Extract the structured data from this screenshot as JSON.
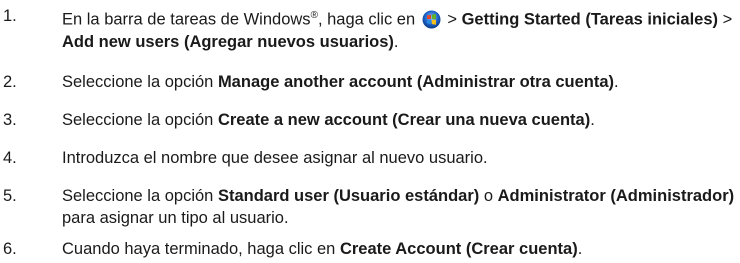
{
  "steps": [
    {
      "number": "1.",
      "parts": {
        "t1": "En la barra de tareas de Windows",
        "reg": "®",
        "t2": ", haga clic en ",
        "t3": " > ",
        "b1": "Getting Started (Tareas iniciales)",
        "t4": " > ",
        "b2": "Add new users (Agregar nuevos usuarios)",
        "t5": "."
      },
      "icon": "windows-start-orb-icon"
    },
    {
      "number": "2.",
      "parts": {
        "t1": "Seleccione la opción ",
        "b1": "Manage another account (Administrar otra cuenta)",
        "t2": "."
      }
    },
    {
      "number": "3.",
      "parts": {
        "t1": "Seleccione la opción ",
        "b1": "Create a new account (Crear una nueva cuenta)",
        "t2": "."
      }
    },
    {
      "number": "4.",
      "parts": {
        "t1": "Introduzca el nombre que desee asignar al nuevo usuario."
      }
    },
    {
      "number": "5.",
      "parts": {
        "t1": "Seleccione la opción ",
        "b1": "Standard user (Usuario estándar)",
        "t2": " o ",
        "b2": "Administrator (Administrador)",
        "t3": " para asignar un tipo al usuario."
      }
    },
    {
      "number": "6.",
      "parts": {
        "t1": "Cuando haya terminado, haga clic en ",
        "b1": "Create Account (Crear cuenta)",
        "t2": "."
      }
    }
  ],
  "colors": {
    "text": "#1a1a1a",
    "orb_blue": "#1e63c8",
    "flag_red": "#e8442a",
    "flag_green": "#5fb32a",
    "flag_blue": "#2a8ae0",
    "flag_yellow": "#f4c01c"
  }
}
